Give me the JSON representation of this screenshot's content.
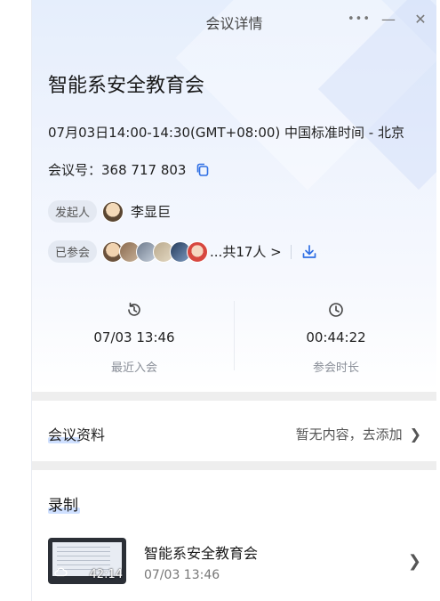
{
  "window": {
    "title": "会议详情",
    "controls": {
      "more": "•••",
      "minimize": "—",
      "close": "✕"
    }
  },
  "meeting": {
    "title": "智能系安全教育会",
    "time": "07月03日14:00-14:30(GMT+08:00) 中国标准时间 - 北京",
    "id_label": "会议号：",
    "id_value": "368 717 803",
    "host_label": "发起人",
    "host_name": "李显巨",
    "attendees_label": "已参会",
    "attendees_more": "...共17人 >"
  },
  "stats": {
    "join": {
      "value": "07/03 13:46",
      "label": "最近入会",
      "icon": "history-icon"
    },
    "duration": {
      "value": "00:44:22",
      "label": "参会时长",
      "icon": "clock-icon"
    }
  },
  "materials": {
    "label": "会议资料",
    "status": "暂无内容，去添加"
  },
  "recording": {
    "label": "录制",
    "item": {
      "title": "智能系安全教育会",
      "time": "07/03 13:46",
      "duration": "42:14"
    }
  },
  "colors": {
    "accent": "#2f6fe4",
    "label_highlight": "#cfe0ff",
    "section_gap": "#eeeeee"
  }
}
